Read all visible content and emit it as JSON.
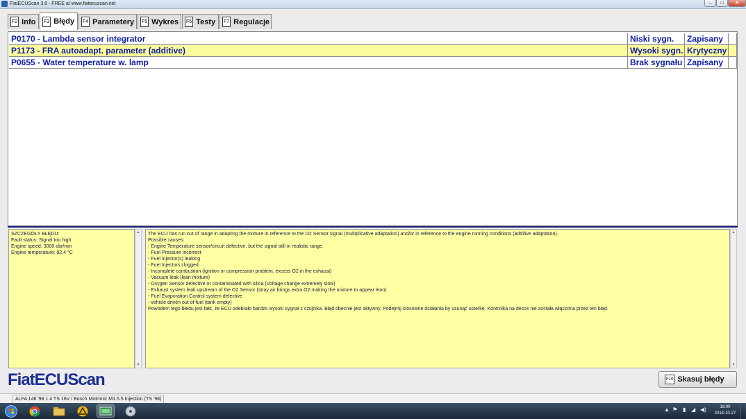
{
  "window": {
    "title": "FiatECUScan 3.6 - FREE at www.fiatecuscan.net"
  },
  "tabs": [
    {
      "key": "F2",
      "label": "Info"
    },
    {
      "key": "F3",
      "label": "Błędy"
    },
    {
      "key": "F4",
      "label": "Parametery"
    },
    {
      "key": "F5",
      "label": "Wykres"
    },
    {
      "key": "F6",
      "label": "Testy"
    },
    {
      "key": "F7",
      "label": "Regulacje"
    }
  ],
  "active_tab": "Błędy",
  "faults": [
    {
      "code": "P0170 - Lambda sensor integrator",
      "signal": "Niski sygn.",
      "status": "Zapisany"
    },
    {
      "code": "P1173 - FRA autoadapt. parameter (additive)",
      "signal": "Wysoki sygn.",
      "status": "Krytyczny"
    },
    {
      "code": "P0655 - Water temperature w. lamp",
      "signal": "Brak sygnału",
      "status": "Zapisany"
    }
  ],
  "details": {
    "left": "SZCZEGÓŁY BŁĘDU:\nFault status: Signal too high\nEngine speed: 3000 obr/min\nEngine temperature: 82,4 °C",
    "right": "The ECU has run out of range in adapting the mixture in reference to the O2 Sensor signal (multiplicative adaptation) and/or in reference to the engine running conditions (additive adaptation).\nPossible causes:\n- Engine Temperature sensor/circuit defective, but the signal still in realistic range.\n- Fuel Pressure incorrect\n- Fuel Injector(s) leaking\n- Fuel Injectors clogged\n- Incomplete combustion (ignition or compression problem, excess O2 in the exhaust)\n- Vacuum leak (lean mixture)\n- Oxygen Sensor defective or contaminated with silica (Voltage change extremely slow)\n- Exhaust system leak upstream of the O2 Sensor (stray air brings extra O2 making the mixture to appear lean)\n- Fuel Evaporation Control system defective\n- vehicle driven out of fuel (tank empty)\nPowodem tego błedu jest fakt, że ECU odebrało bardzo wysoki sygnał z czujnika. Błąd obecnie jest aktywny. Podejmij stosowne działania by usunąć usterkę. Kontrolka na desce nie została włączona przez ten błąd."
  },
  "logo": "FiatECUScan",
  "clear_button": {
    "key": "F10",
    "label": "Skasuj błędy"
  },
  "statusbar": {
    "vehicle": "ALFA 146 '98 1.4 TS 16V / Bosch Motronic M1.5.5 Injection (TS '98)"
  },
  "taskbar": {
    "time": "16:00",
    "date": "2014-10-27"
  },
  "colors": {
    "fault_text": "#0e1fa2",
    "selected_row": "#fbfb9b",
    "details_bg": "#ffffa3",
    "logo": "#1b2e92"
  }
}
